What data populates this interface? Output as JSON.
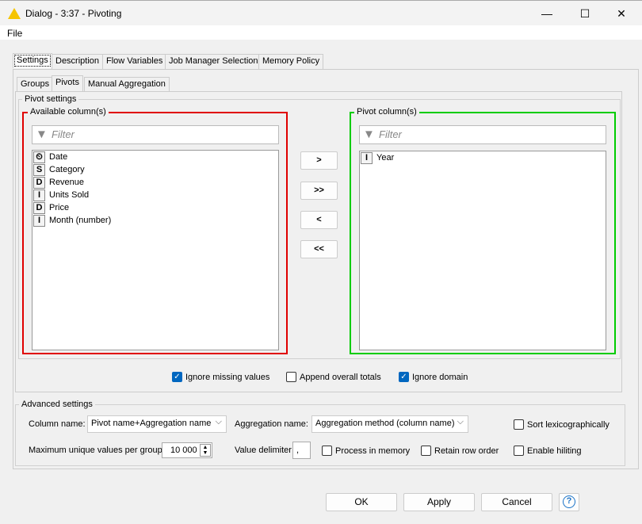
{
  "window": {
    "title": "Dialog - 3:37 - Pivoting",
    "minimize": "—",
    "maximize": "☐",
    "close": "✕"
  },
  "menu": {
    "file": "File"
  },
  "tabs": [
    "Settings",
    "Description",
    "Flow Variables",
    "Job Manager Selection",
    "Memory Policy"
  ],
  "subtabs": [
    "Groups",
    "Pivots",
    "Manual Aggregation"
  ],
  "pivot_settings": {
    "legend": "Pivot settings",
    "available": {
      "legend": "Available column(s)",
      "filter_placeholder": "Filter",
      "items": [
        {
          "type": "⏲",
          "name": "Date"
        },
        {
          "type": "S",
          "name": "Category"
        },
        {
          "type": "D",
          "name": "Revenue"
        },
        {
          "type": "I",
          "name": "Units Sold"
        },
        {
          "type": "D",
          "name": "Price"
        },
        {
          "type": "I",
          "name": "Month (number)"
        }
      ]
    },
    "pivot": {
      "legend": "Pivot column(s)",
      "filter_placeholder": "Filter",
      "items": [
        {
          "type": "I",
          "name": "Year"
        }
      ]
    },
    "buttons": {
      "add": ">",
      "add_all": ">>",
      "remove": "<",
      "remove_all": "<<"
    },
    "ignore_missing": "Ignore missing values",
    "append_totals": "Append overall totals",
    "ignore_domain": "Ignore domain",
    "colors": {
      "available": "#e00000",
      "pivot": "#00cc00"
    }
  },
  "advanced": {
    "legend": "Advanced settings",
    "column_name_label": "Column name:",
    "column_name_value": "Pivot name+Aggregation name",
    "aggregation_name_label": "Aggregation name:",
    "aggregation_name_value": "Aggregation method (column name)",
    "sort_lex": "Sort lexicographically",
    "max_unique_label": "Maximum unique values per group",
    "max_unique_value": "10 000",
    "delimiter_label": "Value delimiter",
    "delimiter_value": ",",
    "process_memory": "Process in memory",
    "retain_order": "Retain row order",
    "enable_hiliting": "Enable hiliting"
  },
  "footer": {
    "ok": "OK",
    "apply": "Apply",
    "cancel": "Cancel",
    "help": "?"
  }
}
